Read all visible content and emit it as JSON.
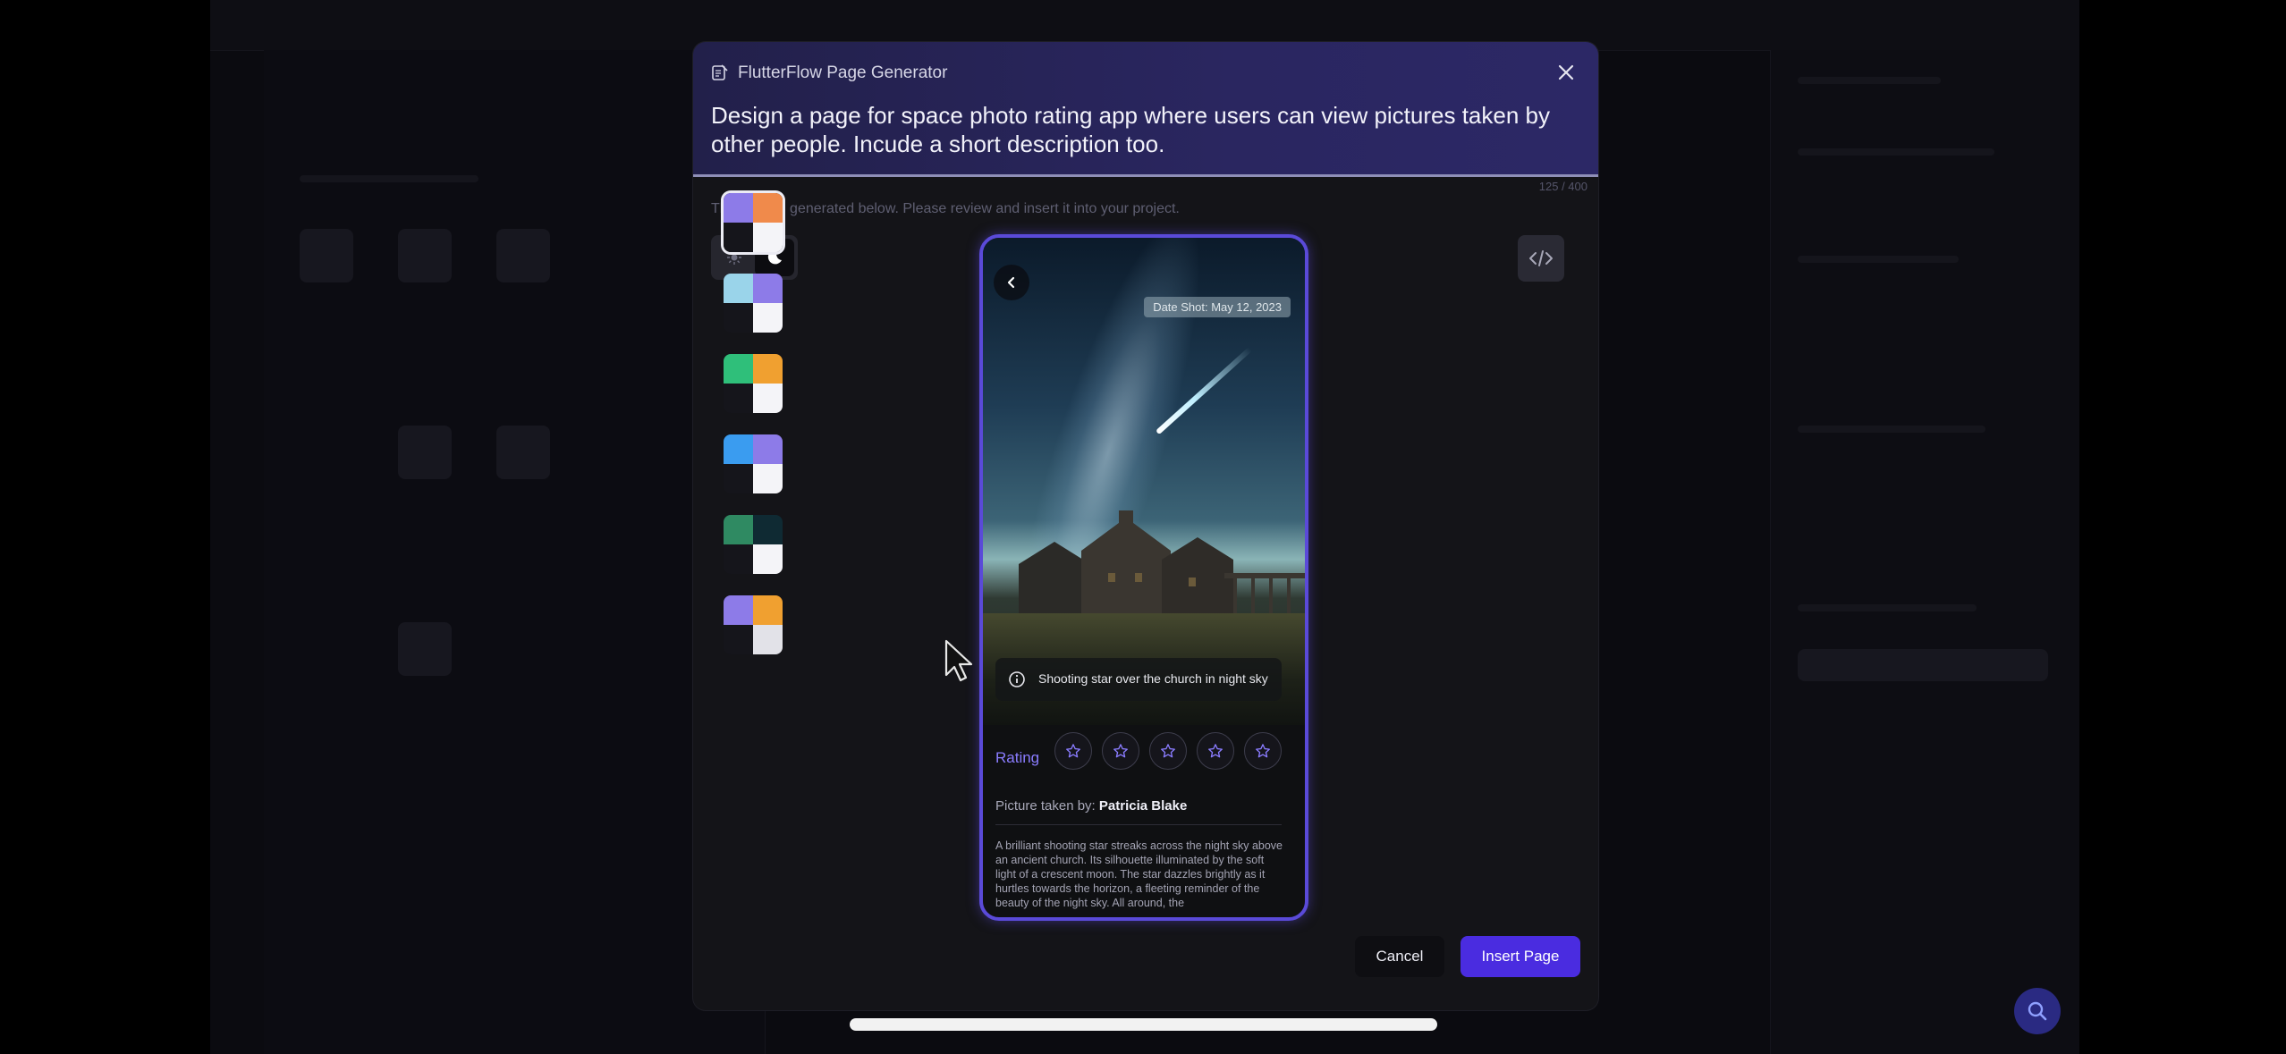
{
  "dialog": {
    "title": "FlutterFlow Page Generator",
    "prompt": "Design a page for space photo rating app where users can view pictures taken by other people. Incude a short description too.",
    "char_counter": "125 / 400",
    "subtitle": "The page is generated below. Please review and insert it into your project."
  },
  "theme_toggle": {
    "selected": "dark"
  },
  "palettes": [
    {
      "colors": [
        "#8d7be8",
        "#f08a4b",
        "#15151b",
        "#f4f4f8"
      ],
      "selected": true
    },
    {
      "colors": [
        "#9ad4ea",
        "#8d7be8",
        "#15151b",
        "#f4f4f8"
      ],
      "selected": false
    },
    {
      "colors": [
        "#2fbf7a",
        "#f0a030",
        "#15151b",
        "#f4f4f8"
      ],
      "selected": false
    },
    {
      "colors": [
        "#3a9cf0",
        "#8d7be8",
        "#15151b",
        "#f4f4f8"
      ],
      "selected": false
    },
    {
      "colors": [
        "#2f8a62",
        "#0f2a33",
        "#15151b",
        "#f4f4f8"
      ],
      "selected": false
    },
    {
      "colors": [
        "#8d7be8",
        "#f0a030",
        "#15151b",
        "#e2e2e8"
      ],
      "selected": false
    }
  ],
  "preview": {
    "date_badge": "Date Shot: May 12, 2023",
    "caption": "Shooting star over the church in night sky",
    "rating_label": "Rating",
    "stars": [
      1,
      2,
      3,
      4,
      5
    ],
    "taken_by_label": "Picture taken by:",
    "photographer": "Patricia Blake",
    "description": "A brilliant shooting star streaks across the night sky above an ancient church. Its silhouette illuminated by the soft light of a crescent moon. The star dazzles brightly as it hurtles towards the horizon, a fleeting reminder of the beauty of the night sky. All around, the"
  },
  "buttons": {
    "cancel": "Cancel",
    "insert": "Insert Page"
  },
  "colors": {
    "accent": "#4a2ce0",
    "rating": "#8a7cff",
    "phone_border": "#5a4ad8"
  }
}
